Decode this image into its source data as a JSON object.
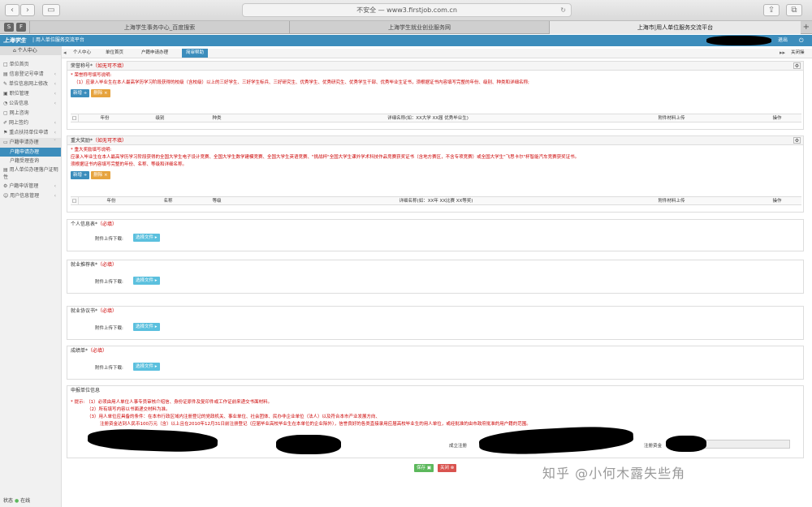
{
  "browser": {
    "url": "不安全 — www3.firstjob.com.cn",
    "tabs": [
      {
        "label": "上海学生事务中心_百度搜索"
      },
      {
        "label": "上海学生就业创业服务网"
      },
      {
        "label": "上海市|用人单位服务交流平台"
      }
    ],
    "pinned": [
      "S",
      "F"
    ]
  },
  "app": {
    "logo": "上海学生",
    "title": "| 用人单位服务交流平台",
    "logout": "退出"
  },
  "sidebar": {
    "header": "个人中心",
    "items": [
      {
        "label": "单位首页"
      },
      {
        "label": "信息登记号申请"
      },
      {
        "label": "单位信息网上修改"
      },
      {
        "label": "职位管理"
      },
      {
        "label": "公告信息"
      },
      {
        "label": "网上咨询"
      },
      {
        "label": "网上签约"
      },
      {
        "label": "重点扶持单位申请"
      },
      {
        "label": "户籍申请办理"
      },
      {
        "label": "户籍申请办理"
      },
      {
        "label": "户籍受理查询"
      },
      {
        "label": "用人单位办理落户证明性"
      },
      {
        "label": "户籍申诉管理"
      },
      {
        "label": "用户信息管理"
      }
    ],
    "status": "状态",
    "online": "在线"
  },
  "subnav": {
    "tabs": [
      {
        "label": "个人中心"
      },
      {
        "label": "单位首页"
      },
      {
        "label": "户籍申请办理"
      },
      {
        "label": "简审帮助"
      }
    ],
    "close_ops": "关闭操"
  },
  "honor": {
    "title": "荣誉称号*",
    "note": "（如无可不填）",
    "sub": "* 荣誉称号填写说明:",
    "text": "（1）应录入毕业生在本人最高学历学习阶段获得的校级（含校级）以上的三好学生、三好学生标兵、三好研究生、优秀学生、优秀研究生、优秀学生干部、优秀毕业生证书，须根据证书内容填写完整的年份、级别、种类和详细名称;",
    "add": "新增 +",
    "del": "删除 ×",
    "cols": [
      "年份",
      "级别",
      "种类",
      "详细名称(如：XX大学 XX届 优秀毕业生)",
      "附件材料上传",
      "操作"
    ]
  },
  "award": {
    "title": "重大奖励*",
    "note": "（如无可不填）",
    "sub": "* 重大奖励填写说明:",
    "text1": "应录入毕业生在本人最高学历学习阶段获得的全国大学生电子设计竞赛、全国大学生数学建模竞赛、全国大学生英语竞赛、\"挑战杯\"全国大学生课外学术科技作品竞赛获奖证书（含地方赛区，不含专项竞赛）或全国大学生\"飞思卡尔\"杯智能汽车竞赛获奖证书。",
    "text2": "须根据证书内容填写完整的年份、名称、等级和详细名称。",
    "add": "新增 +",
    "del": "删除 ×",
    "cols": [
      "年份",
      "名称",
      "等级",
      "详细名称(如：XX年 XX比赛 XX等奖)",
      "附件材料上传",
      "操作"
    ]
  },
  "uploads": [
    {
      "title": "个人信息表*",
      "note": "（必填）",
      "label": "附件上传下载:",
      "btn": "选择文件"
    },
    {
      "title": "就业推荐表*",
      "note": "（必填）",
      "label": "附件上传下载:",
      "btn": "选择文件"
    },
    {
      "title": "就业协议书*",
      "note": "（必填）",
      "label": "附件上传下载:",
      "btn": "选择文件"
    },
    {
      "title": "成绩单*",
      "note": "（必填）",
      "label": "附件上传下载:",
      "btn": "选择文件"
    }
  ],
  "employer": {
    "title": "申报单位信息",
    "hint": "* 提示:",
    "lines": [
      "（1）必须由用人单位人事专员审核介绍信、身份证原件及复印件或工作证前来递交书面材料。",
      "（2）所有填写内容以书面递交材料为准。",
      "（3）用人单位应具备的条件：在本市行政区域内注册登记的党政机关、事业单位、社会团体、民办非企业单位（法人）以及符合本市产业发展方向、",
      "注册资金达到人民币100万元（含）以上且在2010年12月31日前注册登记（应届毕业高校毕业生在本单位的企业除外），信誉良好的各类直接录用应届高校毕业生的用人单位，或经批准的由市政府批准的用户籍的范围。"
    ],
    "info_label": "信息",
    "founded_label": "成立注册",
    "capital_label": "注册资金"
  },
  "actions": {
    "save": "保存",
    "close": "关闭"
  },
  "watermark": "知乎 @小何木露失些角"
}
